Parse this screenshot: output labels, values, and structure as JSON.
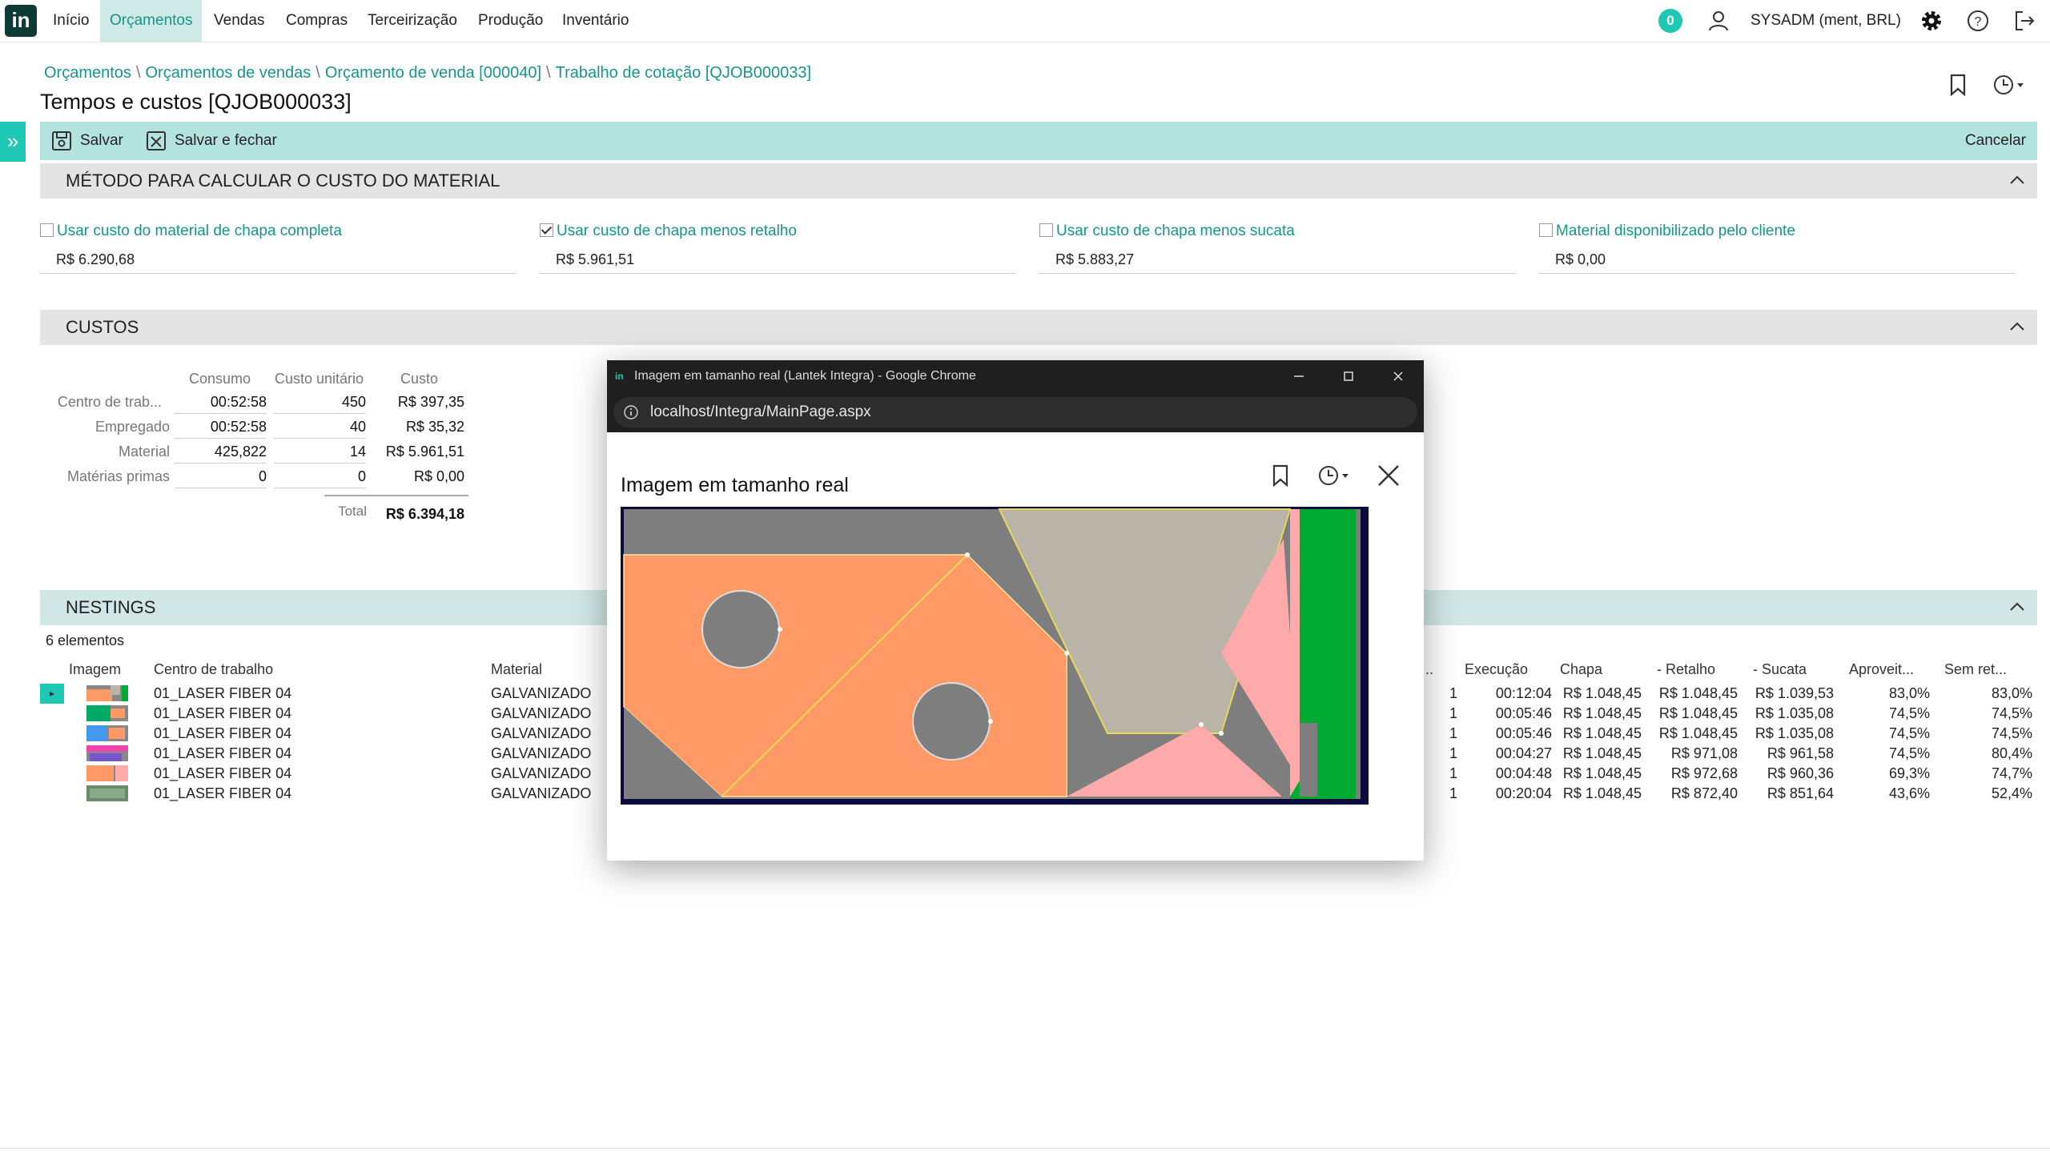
{
  "app": {
    "logo_text": "in"
  },
  "menu": {
    "items": [
      "Início",
      "Orçamentos",
      "Vendas",
      "Compras",
      "Terceirização",
      "Produção",
      "Inventário"
    ],
    "active_index": 1
  },
  "header": {
    "notifications": "0",
    "user": "SYSADM (ment, BRL)"
  },
  "breadcrumb": [
    "Orçamentos",
    "Orçamentos de vendas",
    "Orçamento de venda [000040]",
    "Trabalho de cotação [QJOB000033]"
  ],
  "page": {
    "title": "Tempos e custos [QJOB000033]"
  },
  "toolbar": {
    "save": "Salvar",
    "save_close": "Salvar e fechar",
    "cancel": "Cancelar"
  },
  "material_section": {
    "title": "MÉTODO PARA CALCULAR O CUSTO DO MATERIAL",
    "options": [
      {
        "label": "Usar custo do material de chapa completa",
        "checked": false,
        "value": "R$ 6.290,68"
      },
      {
        "label": "Usar custo de chapa menos retalho",
        "checked": true,
        "value": "R$ 5.961,51"
      },
      {
        "label": "Usar custo de chapa menos sucata",
        "checked": false,
        "value": "R$ 5.883,27"
      },
      {
        "label": "Material disponibilizado pelo cliente",
        "checked": false,
        "value": "R$ 0,00"
      }
    ]
  },
  "costs_section": {
    "title": "CUSTOS",
    "headers": [
      "Consumo",
      "Custo unitário",
      "Custo"
    ],
    "rows": [
      {
        "label": "Centro de trab...",
        "consumo": "00:52:58",
        "unit": "450",
        "cost": "R$ 397,35"
      },
      {
        "label": "Empregado",
        "consumo": "00:52:58",
        "unit": "40",
        "cost": "R$ 35,32"
      },
      {
        "label": "Material",
        "consumo": "425,822",
        "unit": "14",
        "cost": "R$ 5.961,51"
      },
      {
        "label": "Matérias primas",
        "consumo": "0",
        "unit": "0",
        "cost": "R$ 0,00"
      }
    ],
    "total_label": "Total",
    "total_value": "R$ 6.394,18"
  },
  "nestings": {
    "title": "NESTINGS",
    "count": "6 elementos",
    "headers": {
      "image": "Imagem",
      "center": "Centro de trabalho",
      "material": "Material",
      "qty": "..",
      "exec": "Execução",
      "sheet": "Chapa",
      "remnant": "- Retalho",
      "scrap": "- Sucata",
      "usage": "Aproveit...",
      "noremnant": "Sem ret..."
    },
    "rows": [
      {
        "center": "01_LASER FIBER 04",
        "material": "GALVANIZADO",
        "qty": "1",
        "exec": "00:12:04",
        "sheet": "R$ 1.048,45",
        "remnant": "R$ 1.048,45",
        "scrap": "R$ 1.039,53",
        "usage": "83,0%",
        "noremnant": "83,0%"
      },
      {
        "center": "01_LASER FIBER 04",
        "material": "GALVANIZADO",
        "qty": "1",
        "exec": "00:05:46",
        "sheet": "R$ 1.048,45",
        "remnant": "R$ 1.048,45",
        "scrap": "R$ 1.035,08",
        "usage": "74,5%",
        "noremnant": "74,5%"
      },
      {
        "center": "01_LASER FIBER 04",
        "material": "GALVANIZADO",
        "qty": "1",
        "exec": "00:05:46",
        "sheet": "R$ 1.048,45",
        "remnant": "R$ 1.048,45",
        "scrap": "R$ 1.035,08",
        "usage": "74,5%",
        "noremnant": "74,5%"
      },
      {
        "center": "01_LASER FIBER 04",
        "material": "GALVANIZADO",
        "qty": "1",
        "exec": "00:04:27",
        "sheet": "R$ 1.048,45",
        "remnant": "R$ 971,08",
        "scrap": "R$ 961,58",
        "usage": "74,5%",
        "noremnant": "80,4%"
      },
      {
        "center": "01_LASER FIBER 04",
        "material": "GALVANIZADO",
        "qty": "1",
        "exec": "00:04:48",
        "sheet": "R$ 1.048,45",
        "remnant": "R$ 972,68",
        "scrap": "R$ 960,36",
        "usage": "69,3%",
        "noremnant": "74,7%"
      },
      {
        "center": "01_LASER FIBER 04",
        "material": "GALVANIZADO",
        "qty": "1",
        "exec": "00:20:04",
        "sheet": "R$ 1.048,45",
        "remnant": "R$ 872,40",
        "scrap": "R$ 851,64",
        "usage": "43,6%",
        "noremnant": "52,4%"
      }
    ]
  },
  "popup": {
    "window_title": "Imagem em tamanho real (Lantek Integra) - Google Chrome",
    "url": "localhost/Integra/MainPage.aspx",
    "heading": "Imagem em tamanho real"
  },
  "colors": {
    "accent": "#16958a",
    "toolbar": "#b3e3df",
    "toggle": "#1ec8b5",
    "part_orange": "#ff9966",
    "part_grey": "#bab3a8",
    "part_pink": "#ffaaaa",
    "remnant_green": "#00aa33"
  }
}
